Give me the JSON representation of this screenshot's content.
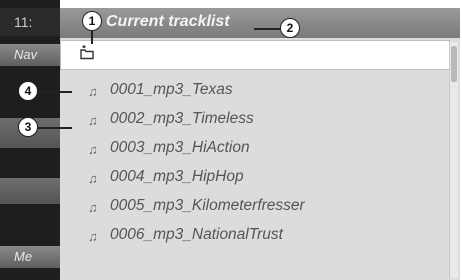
{
  "background": {
    "clock": "11:",
    "nav_label": "Nav",
    "media_label": "Me"
  },
  "panel": {
    "title": "Current tracklist",
    "folder_icon": "folder-up-icon"
  },
  "tracks": [
    {
      "icon": "music-note-icon",
      "name": "0001_mp3_Texas"
    },
    {
      "icon": "music-note-icon",
      "name": "0002_mp3_Timeless"
    },
    {
      "icon": "music-note-icon",
      "name": "0003_mp3_HiAction"
    },
    {
      "icon": "music-note-icon",
      "name": "0004_mp3_HipHop"
    },
    {
      "icon": "music-note-icon",
      "name": "0005_mp3_Kilometerfresser"
    },
    {
      "icon": "music-note-icon",
      "name": "0006_mp3_NationalTrust"
    }
  ],
  "callouts": [
    "1",
    "2",
    "3",
    "4"
  ],
  "colors": {
    "title_bar": "#8a8a8a",
    "panel": "#dcdcdc",
    "dark_background": "#1e1e1e"
  }
}
